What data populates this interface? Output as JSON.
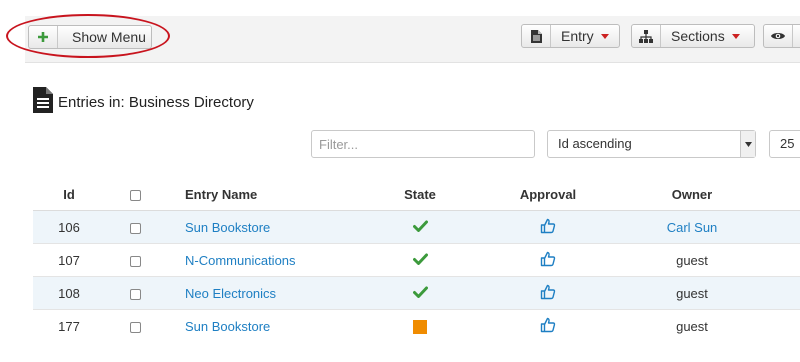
{
  "toolbar": {
    "show_menu_label": "Show Menu",
    "entry_label": "Entry",
    "sections_label": "Sections"
  },
  "header": {
    "title": "Entries in: Business Directory"
  },
  "filters": {
    "filter_placeholder": "Filter...",
    "sort_value": "Id ascending",
    "limit_value": "25"
  },
  "table": {
    "columns": [
      "Id",
      "Entry Name",
      "State",
      "Approval",
      "Owner"
    ],
    "rows": [
      {
        "id": "106",
        "name": "Sun Bookstore",
        "state": "published",
        "approval": "approved",
        "owner": "Carl Sun",
        "owner_is_link": true
      },
      {
        "id": "107",
        "name": "N-Communications",
        "state": "published",
        "approval": "approved",
        "owner": "guest",
        "owner_is_link": false
      },
      {
        "id": "108",
        "name": "Neo Electronics",
        "state": "published",
        "approval": "approved",
        "owner": "guest",
        "owner_is_link": false
      },
      {
        "id": "177",
        "name": "Sun Bookstore",
        "state": "pending",
        "approval": "approved",
        "owner": "guest",
        "owner_is_link": false
      }
    ]
  },
  "colors": {
    "link": "#1e7fc3",
    "check": "#3c9a3c",
    "pending": "#f08c00",
    "highlight": "#c8141e"
  }
}
